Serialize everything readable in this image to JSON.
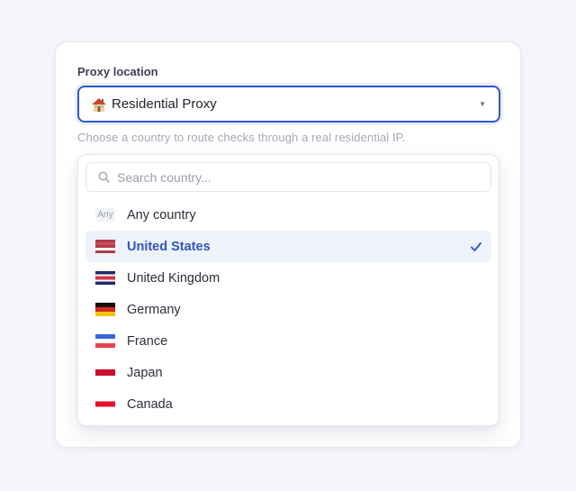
{
  "field": {
    "label": "Proxy location",
    "selected_value": "Residential Proxy",
    "selected_icon": "house-icon",
    "hint": "Choose a country to route checks through a real residential IP."
  },
  "search": {
    "placeholder": "Search country...",
    "value": ""
  },
  "options": [
    {
      "label": "Any country",
      "badge": "Any",
      "icon": "any-badge",
      "selected": false
    },
    {
      "label": "United States",
      "icon": "flag-us-icon",
      "selected": true
    },
    {
      "label": "United Kingdom",
      "icon": "flag-uk-icon",
      "selected": false
    },
    {
      "label": "Germany",
      "icon": "flag-de-icon",
      "selected": false
    },
    {
      "label": "France",
      "icon": "flag-fr-icon",
      "selected": false
    },
    {
      "label": "Japan",
      "icon": "flag-jp-icon",
      "selected": false
    },
    {
      "label": "Canada",
      "icon": "flag-ca-icon",
      "selected": false
    }
  ],
  "colors": {
    "accent": "#3357cc",
    "selected_text": "#2f55c6",
    "selected_bg": "#eef2fb"
  }
}
